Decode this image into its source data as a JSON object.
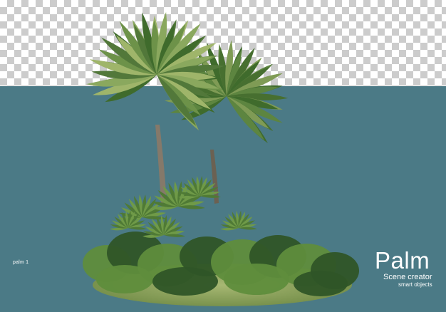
{
  "image": {
    "small_label": "palm 1",
    "title": "Palm",
    "subtitle": "Scene creator",
    "tagline": "smart objects"
  },
  "colors": {
    "background_teal": "#4b7a86",
    "checker_dark": "#cccccc",
    "checker_light": "#ffffff",
    "frond_dark": "#3f6b2c",
    "frond_light": "#9fb56a",
    "trunk": "#7c705d",
    "shrub_dark": "#2f5527",
    "shrub_light": "#5f8d3c",
    "grass": "#8fa55c"
  }
}
